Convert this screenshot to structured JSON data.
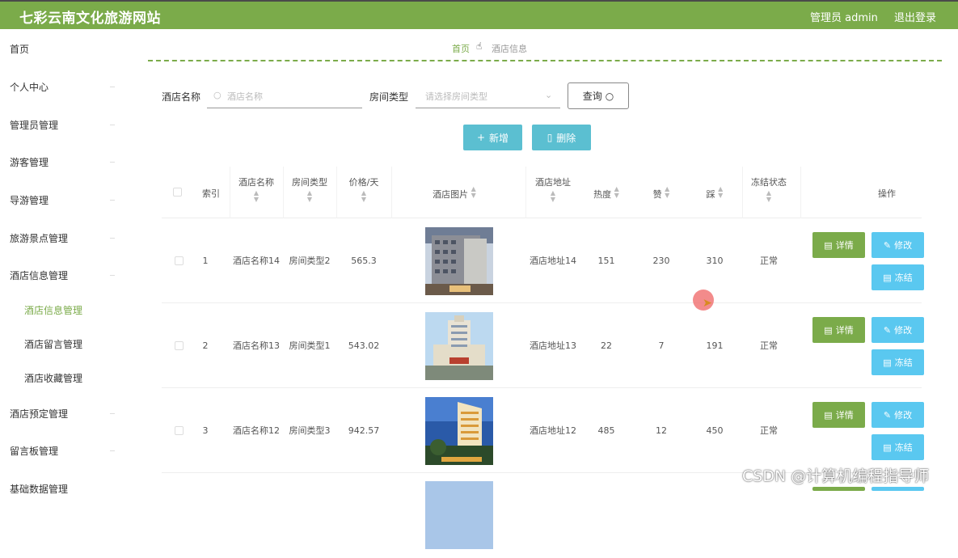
{
  "header": {
    "title": "七彩云南文化旅游网站",
    "user": "管理员 admin",
    "logout": "退出登录",
    "bg_color": "#7bab4a"
  },
  "sidebar": {
    "items": [
      {
        "label": "首页"
      },
      {
        "label": "个人中心"
      },
      {
        "label": "管理员管理"
      },
      {
        "label": "游客管理"
      },
      {
        "label": "导游管理"
      },
      {
        "label": "旅游景点管理"
      },
      {
        "label": "酒店信息管理"
      },
      {
        "label": "酒店信息管理",
        "active": true
      },
      {
        "label": "酒店留言管理"
      },
      {
        "label": "酒店收藏管理"
      },
      {
        "label": "酒店预定管理"
      },
      {
        "label": "留言板管理"
      },
      {
        "label": "基础数据管理"
      }
    ]
  },
  "breadcrumb": {
    "home": "首页",
    "current": "酒店信息"
  },
  "filters": {
    "name_label": "酒店名称",
    "name_placeholder": "酒店名称",
    "type_label": "房间类型",
    "type_placeholder": "请选择房间类型",
    "search_button": "查询"
  },
  "actions": {
    "add": "新增",
    "delete": "删除"
  },
  "table": {
    "headers": {
      "index": "索引",
      "name": "酒店名称",
      "type": "房间类型",
      "price": "价格/天",
      "image": "酒店图片",
      "address": "酒店地址",
      "hot": "热度",
      "like": "赞",
      "dislike": "踩",
      "status": "冻结状态",
      "ops": "操作"
    },
    "rows": [
      {
        "index": "1",
        "name": "酒店名称14",
        "type": "房间类型2",
        "price": "565.3",
        "address": "酒店地址14",
        "hot": "151",
        "like": "230",
        "dislike": "310",
        "status": "正常"
      },
      {
        "index": "2",
        "name": "酒店名称13",
        "type": "房间类型1",
        "price": "543.02",
        "address": "酒店地址13",
        "hot": "22",
        "like": "7",
        "dislike": "191",
        "status": "正常"
      },
      {
        "index": "3",
        "name": "酒店名称12",
        "type": "房间类型3",
        "price": "942.57",
        "address": "酒店地址12",
        "hot": "485",
        "like": "12",
        "dislike": "450",
        "status": "正常"
      }
    ],
    "row_buttons": {
      "detail": "详情",
      "edit": "修改",
      "freeze": "冻结"
    }
  },
  "watermark": "CSDN @计算机编程指导师"
}
